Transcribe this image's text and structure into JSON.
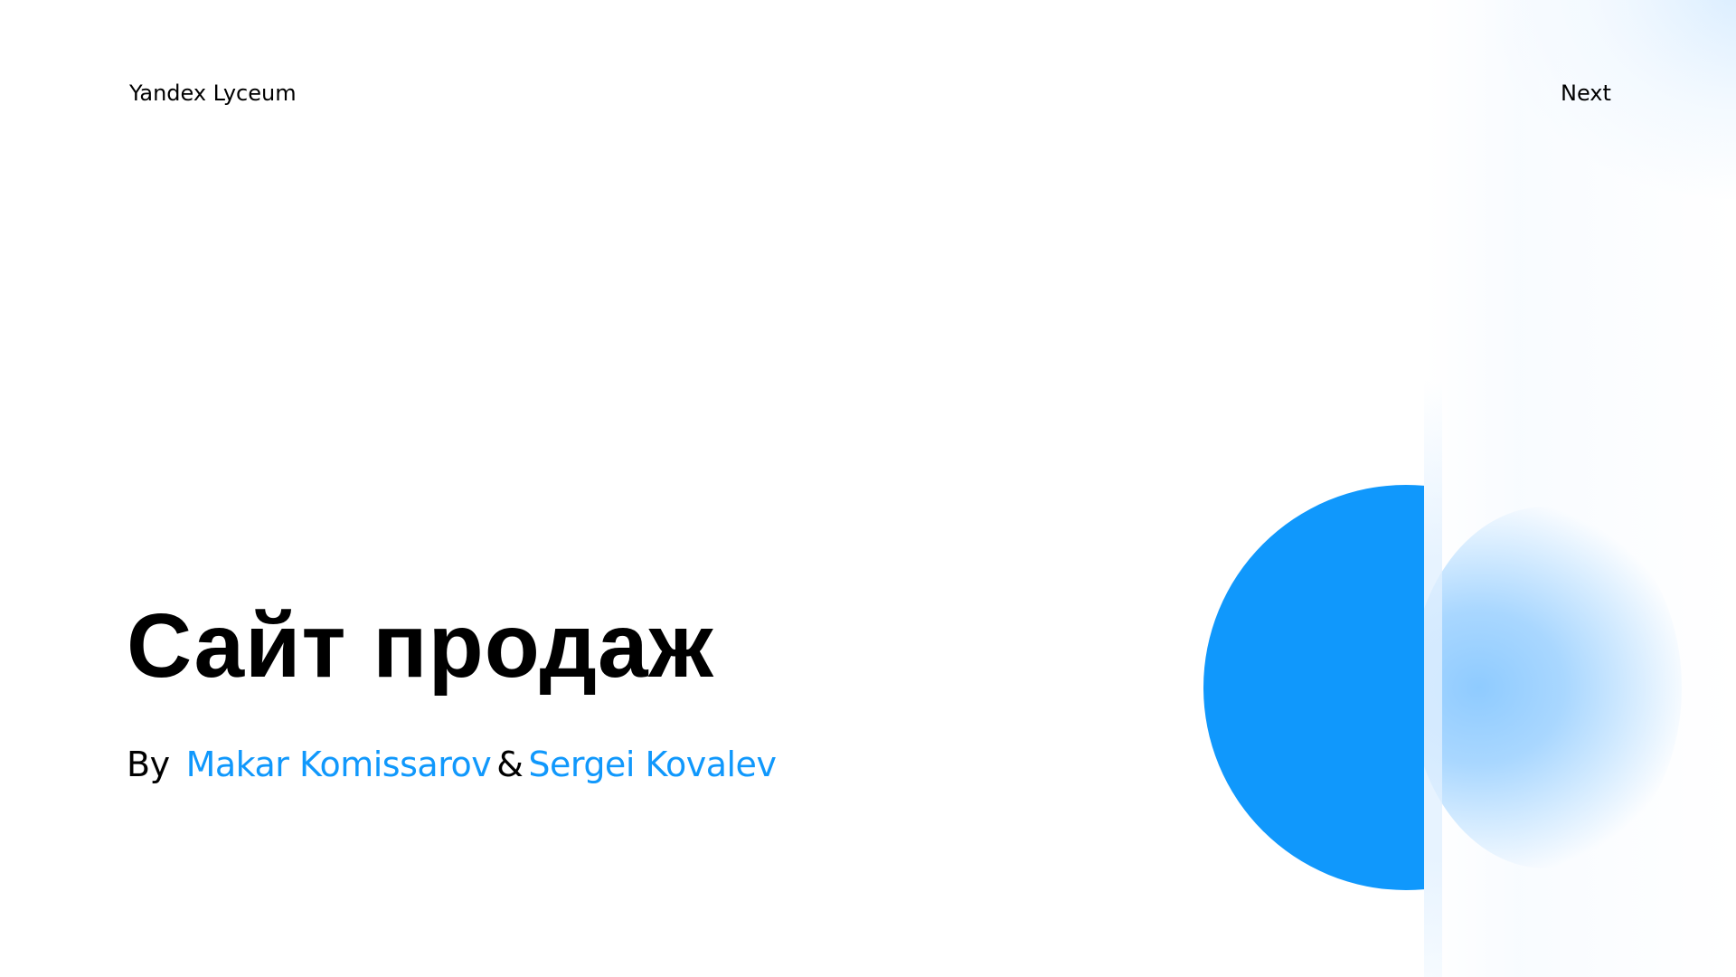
{
  "header": {
    "brand": "Yandex Lyceum",
    "next_label": "Next"
  },
  "hero": {
    "title": "Сайт продаж",
    "by_label": "By",
    "authors": [
      "Makar Komissarov",
      "Sergei Kovalev"
    ],
    "separator": "&"
  },
  "colors": {
    "accent": "#1098fc",
    "text": "#000000",
    "background": "#ffffff"
  }
}
